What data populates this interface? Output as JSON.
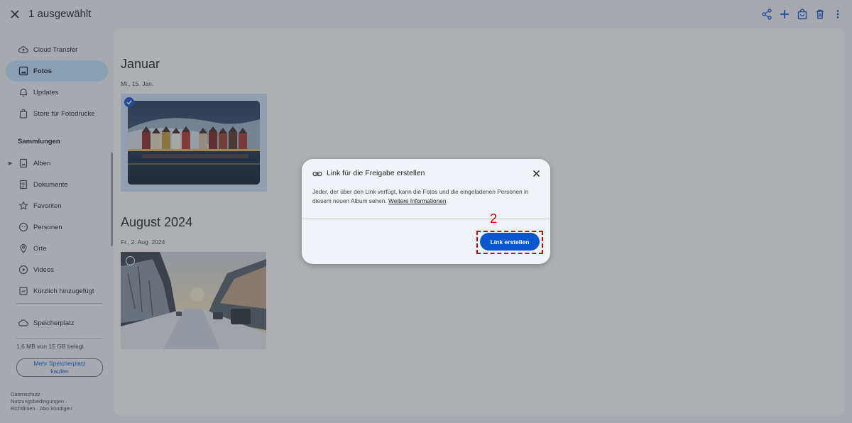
{
  "topbar": {
    "title": "1 ausgewählt",
    "icons": [
      "close-icon",
      "share-icon",
      "add-icon",
      "shopping-bag-icon",
      "delete-icon",
      "more-vert-icon"
    ]
  },
  "sidebar": {
    "items": [
      {
        "label": "Cloud Transfer",
        "icon": "cloud-upload-icon"
      },
      {
        "label": "Fotos",
        "icon": "photo-icon",
        "active": true
      },
      {
        "label": "Updates",
        "icon": "bell-icon"
      },
      {
        "label": "Store für Fotodrucke",
        "icon": "store-icon"
      }
    ],
    "collections_title": "Sammlungen",
    "collections": [
      {
        "label": "Alben",
        "icon": "album-icon"
      },
      {
        "label": "Dokumente",
        "icon": "document-icon"
      },
      {
        "label": "Favoriten",
        "icon": "star-icon"
      },
      {
        "label": "Personen",
        "icon": "person-icon"
      },
      {
        "label": "Orte",
        "icon": "location-icon"
      },
      {
        "label": "Videos",
        "icon": "play-icon"
      },
      {
        "label": "Kürzlich hinzugefügt",
        "icon": "history-icon"
      }
    ],
    "storage_label": "Speicherplatz",
    "storage_used": "1,6 MB von 15 GB belegt",
    "buy_storage": "Mehr Speicherplatz kaufen",
    "footer": {
      "privacy": "Datenschutz",
      "terms": "Nutzungsbedingungen",
      "policies": "Richtlinien",
      "cancel": "Abo kündigen",
      "sep": "·"
    }
  },
  "main": {
    "groups": [
      {
        "month": "Januar",
        "date": "Mi., 15. Jan."
      },
      {
        "month": "August 2024",
        "date": "Fr., 2. Aug. 2024"
      }
    ]
  },
  "dialog": {
    "title": "Link für die Freigabe erstellen",
    "body": "Jeder, der über den Link verfügt, kann die Fotos und die eingeladenen Personen in diesem neuen Album sehen.",
    "more_info": "Weitere Informationen",
    "create_button": "Link erstellen",
    "annotation": "2"
  },
  "colors": {
    "accent": "#0b57d0",
    "active_nav": "#c2e7ff",
    "annotation": "#d50000"
  }
}
